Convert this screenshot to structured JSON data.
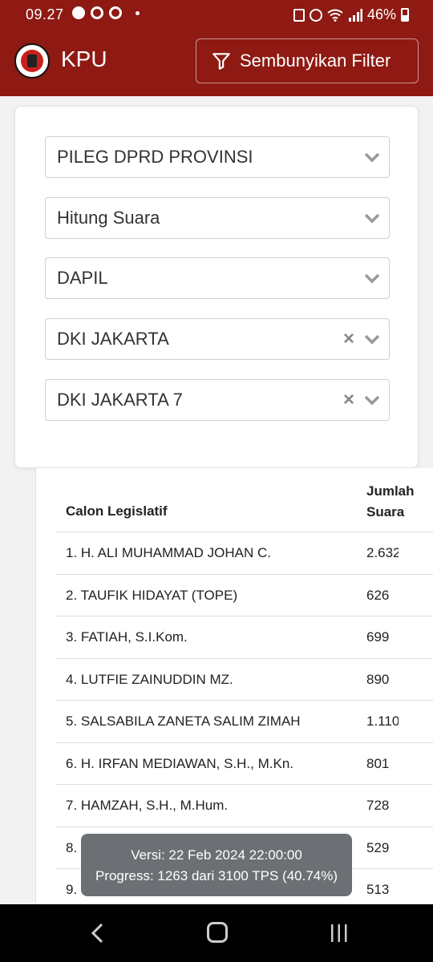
{
  "status_bar": {
    "time": "09.27",
    "battery": "46%",
    "icons": [
      "chat-icon",
      "vpn-icon",
      "whatsapp-icon",
      "notification-dot",
      "nfc-icon",
      "alarm-icon",
      "wifi-icon",
      "signal-icon",
      "battery-icon"
    ]
  },
  "header": {
    "brand": "KPU",
    "logo_icon": "kpu-logo",
    "filter_button_label": "Sembunyikan Filter",
    "filter_icon": "filter-icon",
    "colors": {
      "header_bg": "#8e1a13"
    }
  },
  "filters": [
    {
      "value": "PILEG DPRD PROVINSI",
      "clearable": false
    },
    {
      "value": "Hitung Suara",
      "clearable": false
    },
    {
      "value": "DAPIL",
      "clearable": false
    },
    {
      "value": "DKI JAKARTA",
      "clearable": true
    },
    {
      "value": "DKI JAKARTA 7",
      "clearable": true
    }
  ],
  "table": {
    "headers": {
      "name": "Calon Legislatif",
      "votes_line1": "Jumlah",
      "votes_line2": "Suara"
    },
    "rows": [
      {
        "name": "1. H. ALI MUHAMMAD JOHAN C.",
        "votes": "2.632"
      },
      {
        "name": "2. TAUFIK HIDAYAT (TOPE)",
        "votes": "626"
      },
      {
        "name": "3. FATIAH, S.I.Kom.",
        "votes": "699"
      },
      {
        "name": "4. LUTFIE ZAINUDDIN MZ.",
        "votes": "890"
      },
      {
        "name": "5. SALSABILA ZANETA SALIM ZIMAH",
        "votes": "1.110"
      },
      {
        "name": "6. H. IRFAN MEDIAWAN, S.H., M.Kn.",
        "votes": "801"
      },
      {
        "name": "7. HAMZAH, S.H., M.Hum.",
        "votes": "728"
      },
      {
        "name": "8.",
        "votes": "529"
      },
      {
        "name": "9.",
        "votes": "513"
      }
    ]
  },
  "toast": {
    "version": "Versi: 22 Feb 2024 22:00:00",
    "progress": "Progress: 1263 dari 3100 TPS (40.74%)"
  },
  "nav": {
    "back_icon": "back-icon",
    "home_icon": "home-icon",
    "recents_icon": "recents-icon"
  }
}
